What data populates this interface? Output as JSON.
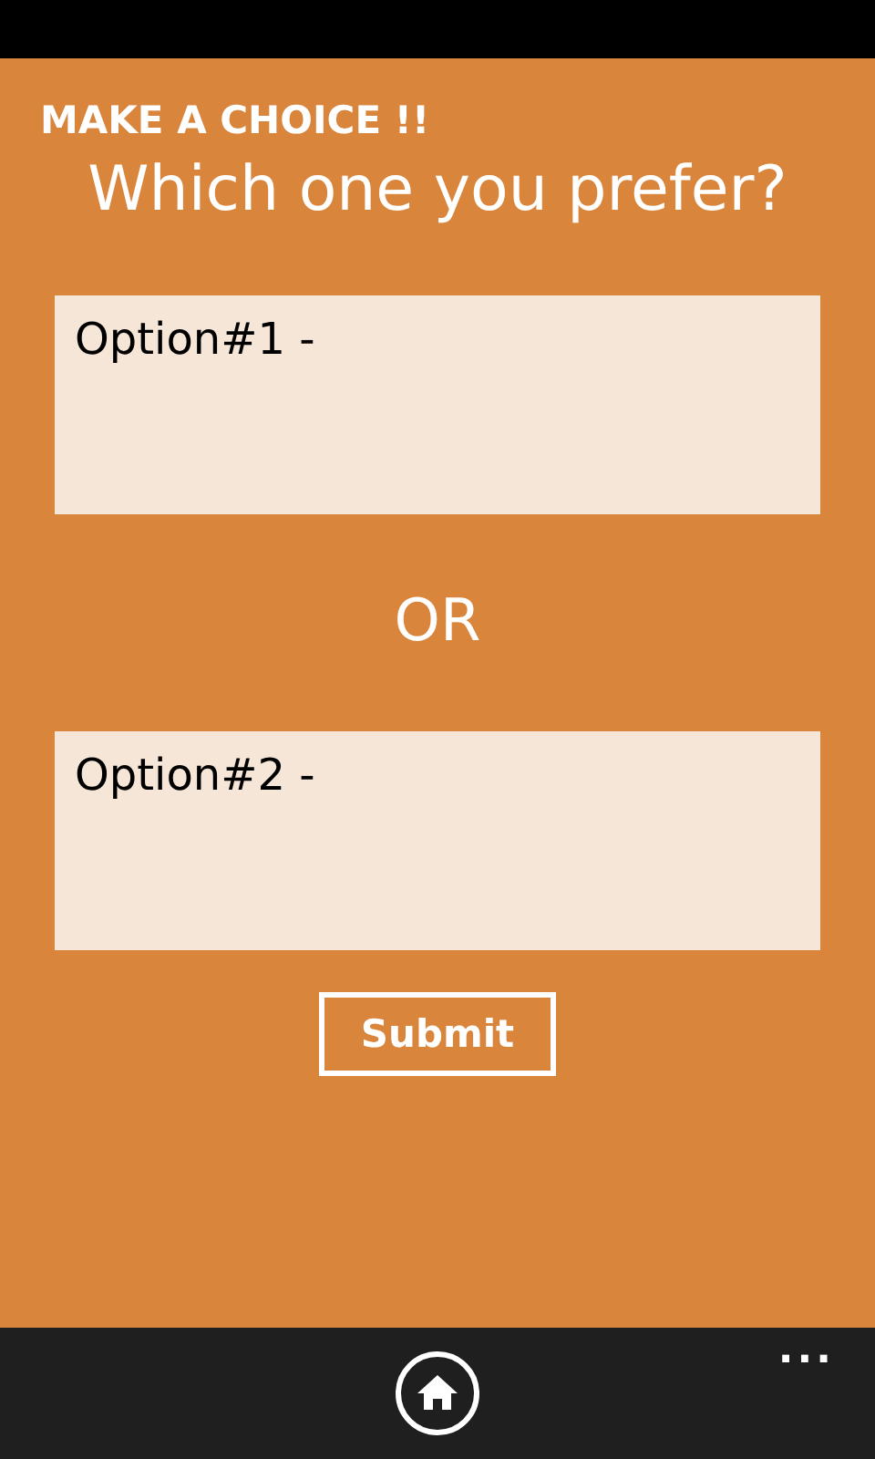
{
  "app_title": "MAKE A CHOICE !!",
  "question": "Which one you prefer?",
  "options": [
    {
      "value": "Option#1 -"
    },
    {
      "value": "Option#2 -"
    }
  ],
  "separator": "OR",
  "submit_button": "Submit",
  "app_bar": {
    "more": "..."
  }
}
